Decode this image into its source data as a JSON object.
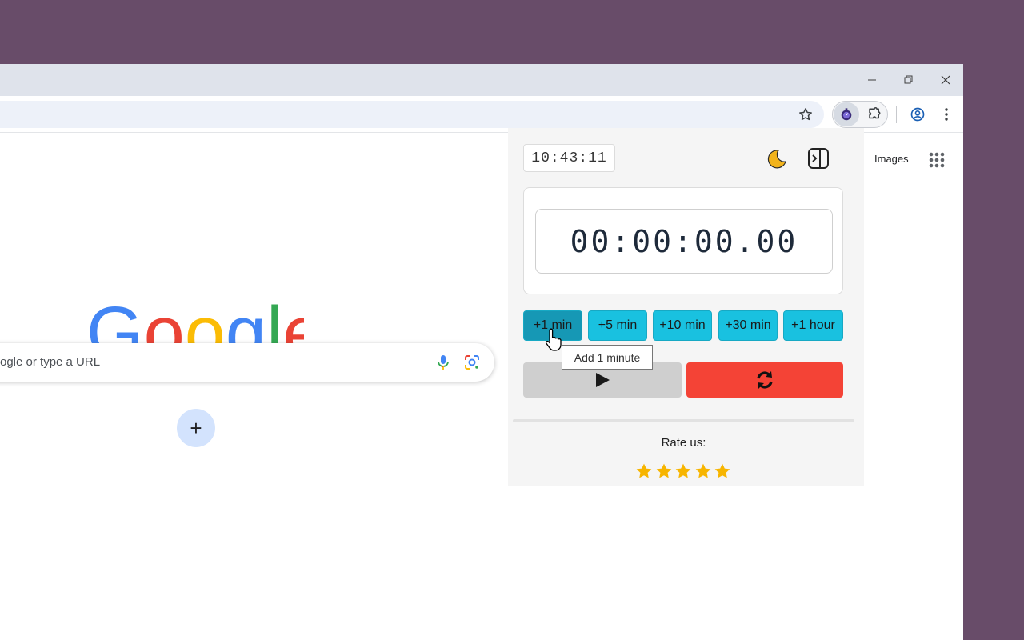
{
  "browser": {
    "window_controls": {
      "minimize": "minimize-icon",
      "restore": "restore-icon",
      "close": "close-icon"
    },
    "toolbar": {
      "bookmark": "star-outline-icon",
      "extension": "stopwatch-extension-icon",
      "extensions_menu": "puzzle-icon",
      "profile": "account-circle-icon",
      "menu": "kebab-menu-icon"
    }
  },
  "google": {
    "images_link": "Images",
    "logo_text": "Google",
    "search_placeholder": "ogle or type a URL",
    "add_shortcut": "+"
  },
  "popup": {
    "clock": "10:43:11",
    "timer_display": "00:00:00.00",
    "add_buttons": [
      "+1 min",
      "+5 min",
      "+10 min",
      "+30 min",
      "+1 hour"
    ],
    "tooltip": "Add 1 minute",
    "rate_label": "Rate us:",
    "rating": 5,
    "colors": {
      "button": "#19c1e0",
      "button_hover": "#1698b5",
      "reset": "#f44336",
      "play": "#cfcfcf",
      "star": "#f7b500"
    }
  }
}
